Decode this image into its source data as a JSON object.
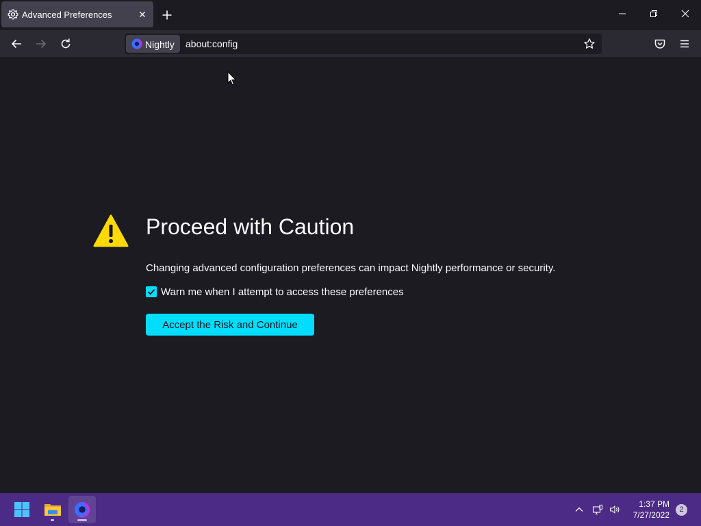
{
  "window": {
    "tab": {
      "title": "Advanced Preferences",
      "icon": "gear-icon"
    },
    "controls": [
      "minimize-icon",
      "restore-icon",
      "close-icon"
    ]
  },
  "toolbar": {
    "identity_label": "Nightly",
    "url": "about:config"
  },
  "page": {
    "heading": "Proceed with Caution",
    "description": "Changing advanced configuration preferences can impact Nightly performance or security.",
    "checkbox_label": "Warn me when I attempt to access these preferences",
    "checkbox_checked": true,
    "button_label": "Accept the Risk and Continue"
  },
  "taskbar": {
    "apps": [
      "start-icon",
      "file-explorer-icon",
      "firefox-nightly-icon"
    ],
    "time": "1:37 PM",
    "date": "7/27/2022",
    "notification_count": "2"
  },
  "colors": {
    "accent": "#00ddff",
    "warning": "#ffd900",
    "page_bg": "#1c1b22",
    "taskbar_bg": "#4b2b85"
  }
}
